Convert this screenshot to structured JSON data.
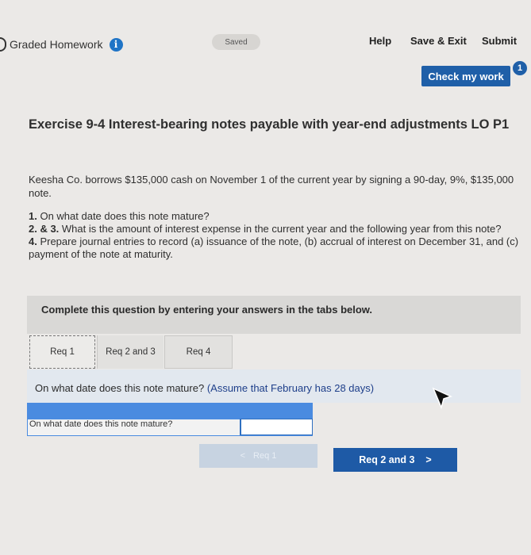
{
  "header": {
    "title": "Graded Homework",
    "info_icon": "i",
    "saved_label": "Saved",
    "help": "Help",
    "save_exit": "Save & Exit",
    "submit": "Submit",
    "check_work": "Check my work",
    "badge_count": "1"
  },
  "exercise": {
    "title": "Exercise 9-4 Interest-bearing notes payable with year-end adjustments LO P1",
    "intro": "Keesha Co. borrows $135,000 cash on November 1 of the current year by signing a 90-day, 9%, $135,000 note.",
    "q1_num": "1.",
    "q1": " On what date does this note mature?",
    "q2_num": "2. & 3.",
    "q2": " What is the amount of interest expense in the current year and the following year from this note?",
    "q4_num": "4.",
    "q4": " Prepare journal entries to record (a) issuance of the note, (b) accrual of interest on December 31, and (c) payment of the note at maturity."
  },
  "instructions": "Complete this question by entering your answers in the tabs below.",
  "tabs": [
    {
      "label": "Req 1"
    },
    {
      "label": "Req 2 and 3"
    },
    {
      "label": "Req 4"
    }
  ],
  "panel": {
    "question": "On what date does this note mature?",
    "hint": "(Assume that February has 28 days)",
    "answer_label": "On what date does this note mature?",
    "answer_value": ""
  },
  "nav": {
    "prev_label": "Req 1",
    "prev_chevron": "<",
    "next_label": "Req 2 and 3",
    "next_chevron": ">"
  },
  "colors": {
    "accent": "#1f5fa8",
    "answer_header": "#4a8be0"
  }
}
